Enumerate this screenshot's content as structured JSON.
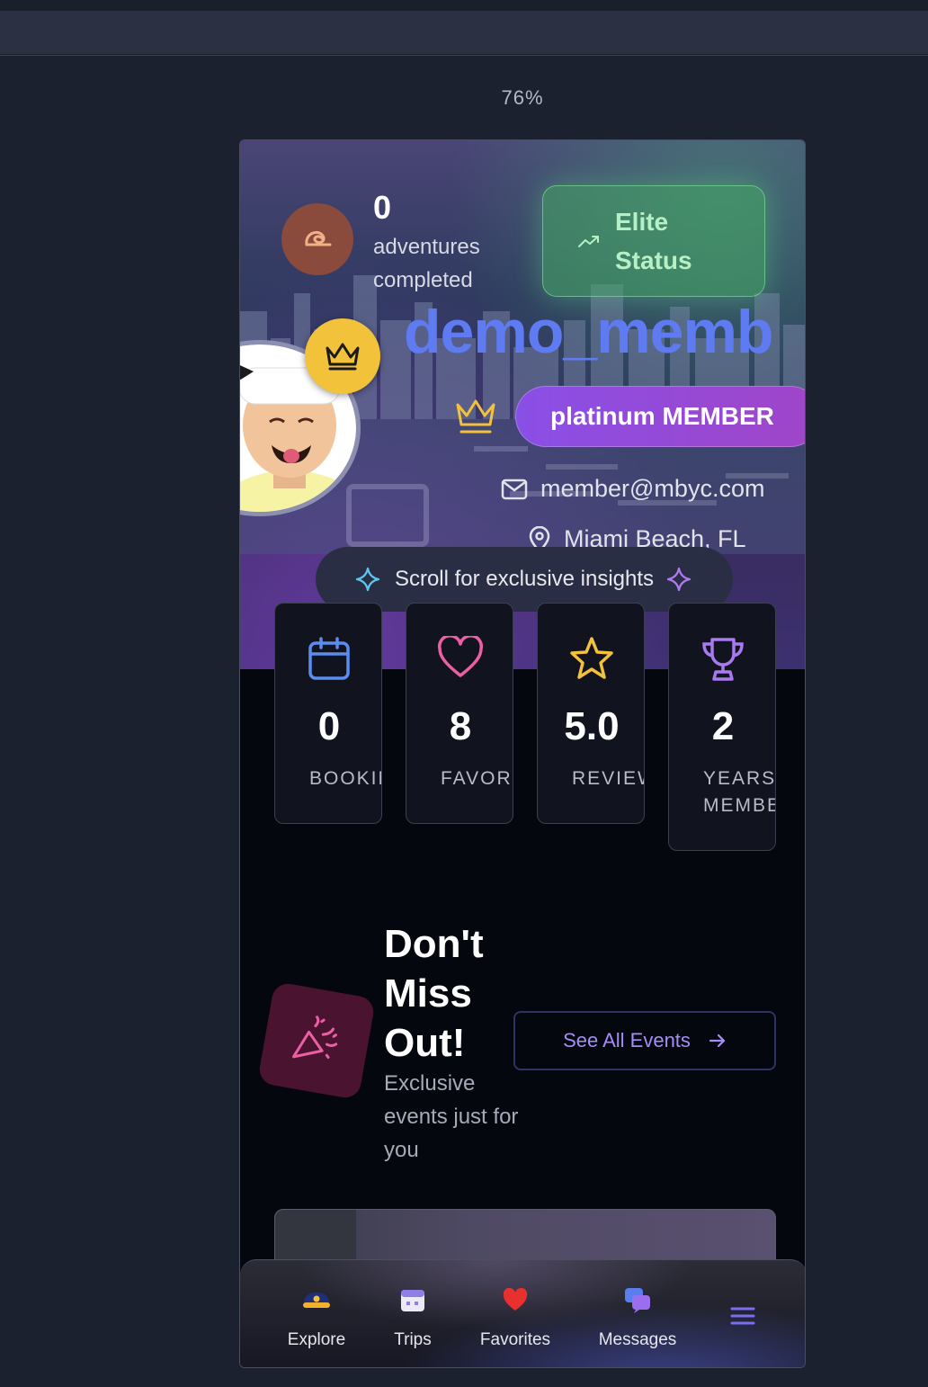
{
  "browser": {
    "zoom": "76%"
  },
  "hero": {
    "adventures_count": "0",
    "adventures_label": "adventures completed",
    "elite_status": "Elite Status",
    "username": "demo_memb",
    "tier": "platinum MEMBER",
    "email": "member@mbyc.com",
    "location": "Miami Beach, FL",
    "scroll_hint": "Scroll for exclusive insights"
  },
  "stats": [
    {
      "icon": "calendar-icon",
      "value": "0",
      "label": "BOOKIN",
      "color": "#5b8def"
    },
    {
      "icon": "heart-icon",
      "value": "8",
      "label": "FAVORI",
      "color": "#ec5fa4"
    },
    {
      "icon": "star-icon",
      "value": "5.0",
      "label": "REVIEW",
      "color": "#f2c23a"
    },
    {
      "icon": "trophy-icon",
      "value": "2",
      "label": "YEARS MEMBE",
      "color": "#a77af0"
    }
  ],
  "events": {
    "title": "Don't Miss Out!",
    "subtitle": "Exclusive events just for you",
    "see_all_label": "See All Events"
  },
  "tabbar": {
    "items": [
      {
        "label": "Explore",
        "icon": "captain-hat-icon"
      },
      {
        "label": "Trips",
        "icon": "calendar-icon"
      },
      {
        "label": "Favorites",
        "icon": "heart-icon"
      },
      {
        "label": "Messages",
        "icon": "chat-bubbles-icon"
      },
      {
        "label": "",
        "icon": "menu-icon"
      }
    ]
  },
  "colors": {
    "username": "#5f7bf2",
    "tier_gradient": [
      "#8a4fe6",
      "#a045c7"
    ],
    "elite_bg": "#46aa64",
    "see_all_text": "#a68cf5"
  }
}
